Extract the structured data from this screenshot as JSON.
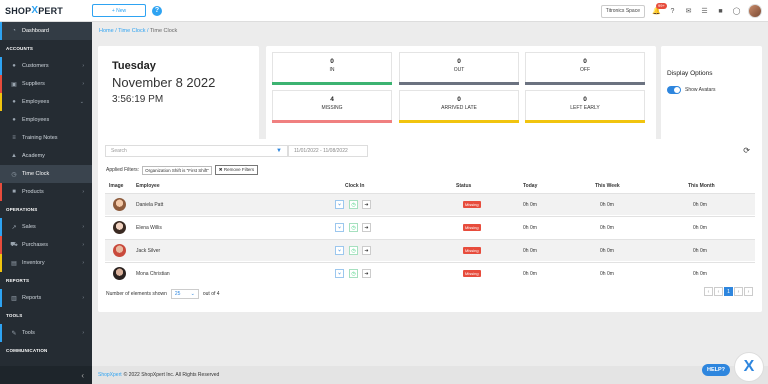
{
  "brand": {
    "logo_left": "SHOP",
    "logo_x": "X",
    "logo_right": "PERT"
  },
  "topbar": {
    "new_label": "+ New",
    "help": "?",
    "space_label": "Titronics Space",
    "notif_badge": "99+"
  },
  "sidebar": {
    "dashboard": "Dashboard",
    "accounts_head": "ACCOUNTS",
    "customers": "Customers",
    "suppliers": "Suppliers",
    "employees": "Employees",
    "employees_sub": "Employees",
    "training_notes": "Training Notes",
    "academy": "Academy",
    "time_clock": "Time Clock",
    "products": "Products",
    "operations_head": "OPERATIONS",
    "sales": "Sales",
    "purchases": "Purchases",
    "inventory": "Inventory",
    "reports_head": "REPORTS",
    "reports": "Reports",
    "tools_head": "TOOLS",
    "tools": "Tools",
    "communication_head": "COMMUNICATION",
    "collapse": "‹"
  },
  "breadcrumb": {
    "home": "Home",
    "sep": " / ",
    "time_clock": "Time Clock",
    "current": "Time Clock"
  },
  "datetime": {
    "day": "Tuesday",
    "date": "November 8 2022",
    "time": "3:56:19 PM"
  },
  "stats": [
    {
      "value": "0",
      "label": "IN",
      "color": "#3cb371"
    },
    {
      "value": "0",
      "label": "OUT",
      "color": "#6b7280"
    },
    {
      "value": "0",
      "label": "OFF",
      "color": "#6b7280"
    },
    {
      "value": "4",
      "label": "MISSING",
      "color": "#f08080"
    },
    {
      "value": "0",
      "label": "ARRIVED LATE",
      "color": "#f1c40f"
    },
    {
      "value": "0",
      "label": "LEFT EARLY",
      "color": "#f1c40f"
    }
  ],
  "display_options": {
    "title": "Display Options",
    "toggle_label": "Show Avatars"
  },
  "table": {
    "search_placeholder": "Search",
    "date_range": "11/01/2022 - 11/08/2022",
    "applied_label": "Applied Filters:",
    "filter_chip": "Organization Shift is \"First Shift\"",
    "remove_filters": "✖ Remove Filters",
    "headers": {
      "image": "Image",
      "employee": "Employee",
      "clock_in": "Clock In",
      "status": "Status",
      "today": "Today",
      "this_week": "This Week",
      "this_month": "This Month"
    },
    "rows": [
      {
        "name": "Daniela Patt",
        "status": "Missing",
        "today": "0h 0m",
        "week": "0h 0m",
        "month": "0h 0m"
      },
      {
        "name": "Elena Willis",
        "status": "Missing",
        "today": "0h 0m",
        "week": "0h 0m",
        "month": "0h 0m"
      },
      {
        "name": "Jack Silver",
        "status": "Missing",
        "today": "0h 0m",
        "week": "0h 0m",
        "month": "0h 0m"
      },
      {
        "name": "Mona Christian",
        "status": "Missing",
        "today": "0h 0m",
        "week": "0h 0m",
        "month": "0h 0m"
      }
    ],
    "elements_label": "Number of elements shown",
    "per_page": "25",
    "out_of": "out of 4",
    "pager": {
      "first": "‹",
      "prev": "‹",
      "page": "1",
      "next": "›",
      "last": "›"
    }
  },
  "footer": {
    "brand": "ShopXpert",
    "text": "© 2022 ShopXpert Inc. All Rights Reserved"
  },
  "help_float": "HELP?"
}
